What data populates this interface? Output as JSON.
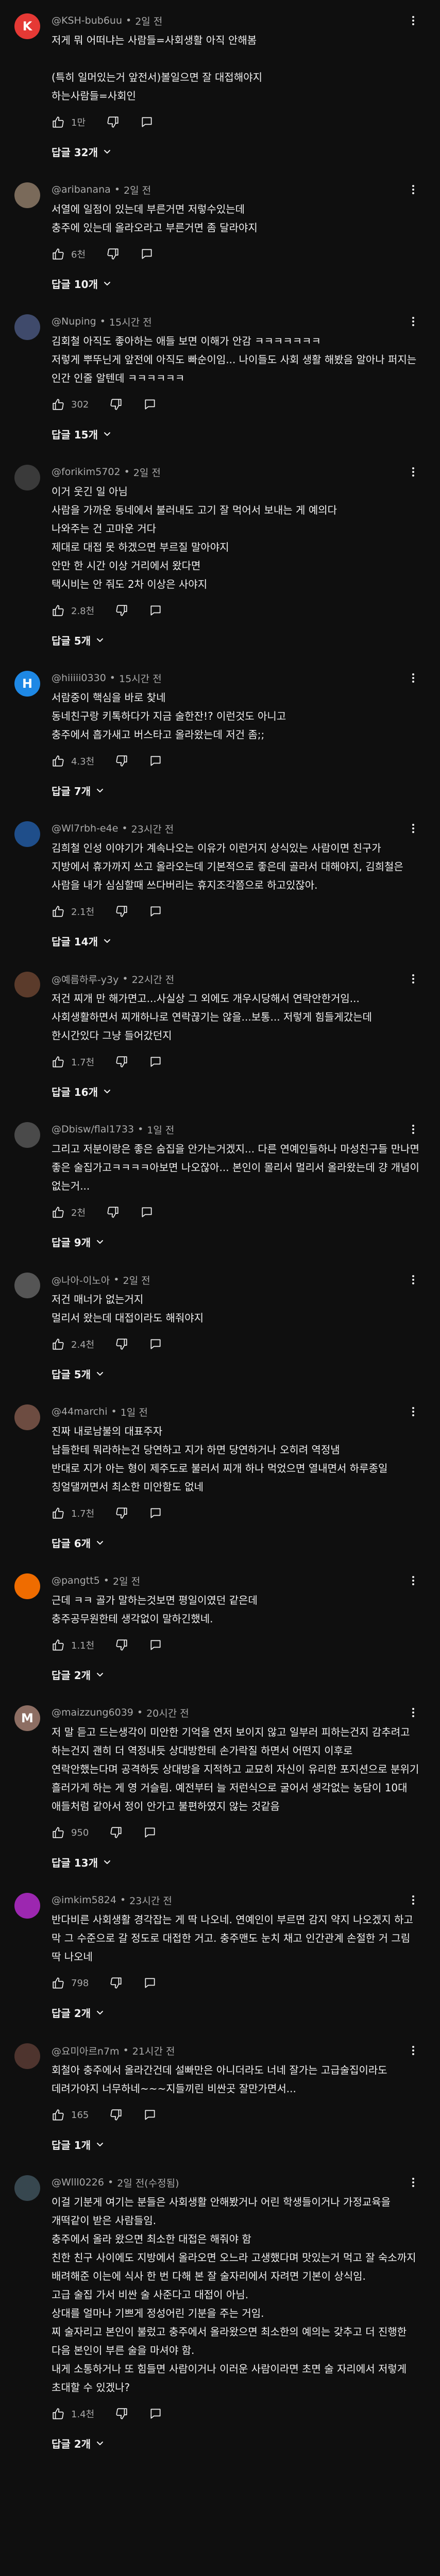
{
  "labels": {
    "reply": "답글"
  },
  "comments": [
    {
      "author": "@KSH-bub6uu",
      "time": "2일 전",
      "avatar_letter": "K",
      "avatar_color": "#e53935",
      "text": "저게 뭐 어떠냐는 사람들=사회생활 아직 안해봄\n\n(특히 일머있는거 앞전서)볼일으면 잘 대접해야지\n하는사람들=사회인",
      "likes": "1만",
      "replies": "답글 32개"
    },
    {
      "author": "@aribanana",
      "time": "2일 전",
      "avatar_letter": "",
      "avatar_color": "#7a6a5a",
      "text": "서열에 일점이 있는데 부른거면 저렇수있는데\n충주에 있는데 올라오라고 부른거면 좀 달라야지",
      "likes": "6천",
      "replies": "답글 10개"
    },
    {
      "author": "@Nuping",
      "time": "15시간 전",
      "avatar_letter": "",
      "avatar_color": "#3f4a6b",
      "text": "김회철 아직도 좋아하는 애들 보면 이해가 안감 ㅋㅋㅋㅋㅋㅋㅋ\n저렇게 뿌뚜닌게 앞전에 아직도 빠순이임... 나이들도 사회 생활 해봤음 알아나 퍼지는 인간 인줄 알텐데 ㅋㅋㅋㅋㅋㅋ",
      "likes": "302",
      "replies": "답글 15개"
    },
    {
      "author": "@forikim5702",
      "time": "2일 전",
      "avatar_letter": "",
      "avatar_color": "#3a3a3a",
      "text": "이거 웃긴 일 아님\n사람을 가까운 동네에서 불러내도 고기 잘 먹어서 보내는 게 예의다\n나와주는 건 고마운 거다\n제대로 대접 못 하겠으면 부르질 말아야지\n안만 한 시간 이상 거리에서 왔다면\n택시비는 안 줘도 2차 이상은 사야지",
      "likes": "2.8천",
      "replies": "답글 5개"
    },
    {
      "author": "@hiiiii0330",
      "time": "15시간 전",
      "avatar_letter": "H",
      "avatar_color": "#1e88e5",
      "text": "서람중이 핵심을 바로 찾네\n동네친구랑 키톡하다가 지금 술한잔!? 이런것도 아니고\n충주에서 흡가새고 버스타고 올라왔는데 저건 좀;;",
      "likes": "4.3천",
      "replies": "답글 7개"
    },
    {
      "author": "@Wl7rbh-e4e",
      "time": "23시간 전",
      "avatar_letter": "",
      "avatar_color": "#1f4e8a",
      "text": "김희철 인성 이야기가 계속나오는 이유가 이런거지 상식있는 사람이면 친구가 지방에서 휴가까지 쓰고 올라오는데 기본적으로 좋은데 골라서 대해야지, 김희철은 사람을 내가 심심할때 쓰다버리는 휴지조각쯤으로 하고있잖아.",
      "likes": "2.1천",
      "replies": "답글 14개"
    },
    {
      "author": "@예름하루-y3y",
      "time": "22시간 전",
      "avatar_letter": "",
      "avatar_color": "#5b3b2b",
      "text": "저건 찌개 만 해가면고...사실상 그 외에도 개우시당해서 연락안한거임...사회생활하면서 찌개하나로 연락끊기는 않을...보통... 저렇게 힘들게갔는데 한시간있다 그냥 들어갔던지",
      "likes": "1.7천",
      "replies": "답글 16개"
    },
    {
      "author": "@Dbisw/flal1733",
      "time": "1일 전",
      "avatar_letter": "",
      "avatar_color": "#4a4a4a",
      "text": "그리고 저분이랑은 좋은 숨집을 안가는거겠지... 다른 연예인들하나 마성친구들 만나면 좋은 술집가고ㅋㅋㅋㅋ아보면 나오잖아... 본인이 몰리서 멀리서 올라왔는데 걍 개념이 없는거...",
      "likes": "2천",
      "replies": "답글 9개"
    },
    {
      "author": "@나아-이노아",
      "time": "2일 전",
      "avatar_letter": "",
      "avatar_color": "#555555",
      "text": "저건 매너가 없는거지\n멀리서 왔는데 대접이라도 해줘야지",
      "likes": "2.4천",
      "replies": "답글 5개"
    },
    {
      "author": "@44marchi",
      "time": "1일 전",
      "avatar_letter": "",
      "avatar_color": "#6d4c41",
      "text": "진짜 내로남불의 대표주자\n남들한테 뭐라하는건 당연하고 지가 하면 당연하거나 오히려 역정냄\n반대로 지가 아는 형이 제주도로 불러서 찌개 하나 먹었으면 열내면서 하루종일 칭얼댈꺼면서 최소한 미안함도 없네",
      "likes": "1.7천",
      "replies": "답글 6개"
    },
    {
      "author": "@pangtt5",
      "time": "2일 전",
      "avatar_letter": "",
      "avatar_color": "#ef6c00",
      "text": "근데 ㅋㅋ 골가 말하는것보면 평일이였던 같은데\n충주공무원한테 생각없이 말하긴했네.",
      "likes": "1.1천",
      "replies": "답글 2개"
    },
    {
      "author": "@maizzung6039",
      "time": "20시간 전",
      "avatar_letter": "M",
      "avatar_color": "#8d6e63",
      "text": "저 말 듣고 드는생각이 미안한 기억을 연저 보이지 않고 일부러 피하는건지 감추려고 하는건지 괜히 더 역정내듯 상대방한테 손가락질 하면서 어떤지 이후로 연락안했는다며 공격하듯 상대방을 지적하고 교묘히 자신이 유리한 포지션으로 분위기 흘러가게 하는 게 영 거슬림. 예전부터 늘 저런식으로 굴어서 생각없는 농담이 10대 애들처럼 같아서 정이 안가고 불편하였지 않는 것같음",
      "likes": "950",
      "replies": "답글 13개"
    },
    {
      "author": "@imkim5824",
      "time": "23시간 전",
      "avatar_letter": "",
      "avatar_color": "#9c27b0",
      "text": "반다비른 사회생활 경각잡는 게 딱 나오네. 연예인이 부르면 감지 약지 나오겠지 하고 막 그 수준으로 갈 정도로 대접한 거고. 충주맨도 눈치 채고 인간관계 손절한 거 그림 딱 나오네",
      "likes": "798",
      "replies": "답글 2개"
    },
    {
      "author": "@요미아르n7m",
      "time": "21시간 전",
      "avatar_letter": "",
      "avatar_color": "#4e342e",
      "text": "회철아 충주에서 올라간건데 설빠만은 아니더라도 너네 잘가는 고급술집이라도 데려가야지 너무하네~~~지들끼린 비싼곳 잘만가면서...",
      "likes": "165",
      "replies": "답글 1개"
    },
    {
      "author": "@Wlll0226",
      "time": "2일 전(수정됨)",
      "avatar_letter": "",
      "avatar_color": "#37474f",
      "text": "이걸 기분게 여기는 분들은 사회생활 안해봤거나 어린 학생들이거나 가정교육을 개떡같이 받은 사람들임.\n충주에서 올라 왔으면 최소한 대접은 해줘야 함\n친한 친구 사이에도 지방에서 올라오면 오느라 고생했다며 맛있는거 먹고 잘 숙소까지 배려해준 이는에 식사 한 번 다해 본 잘 술자리에서 자려면 기본이 상식임.\n고급 술집 가서 비싼 술 사준다고 대접이 아님.\n상대를 얼마나 기쁘게 정성어린 기분을 주는 거임.\n찌 술자리고 본인이 불렀고 충주에서 올라왔으면 최소한의 예의는 갖추고 더 진행한 다음 본인이 부른 술을 마셔야 함.\n내게 소통하거나 또 힘들면 사람이거나 이러운 사람이라면 초면 술 자리에서 저렇게 초대할 수 있겠나?",
      "likes": "1.4천",
      "replies": "답글 2개"
    }
  ]
}
